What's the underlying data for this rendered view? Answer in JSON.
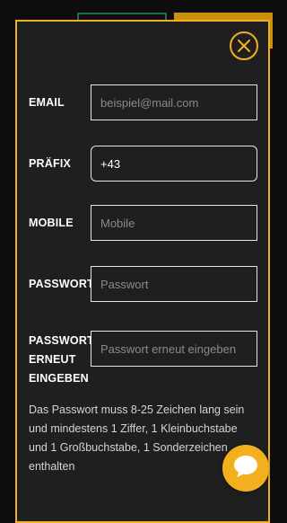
{
  "form": {
    "email": {
      "label": "EMAIL",
      "placeholder": "beispiel@mail.com",
      "value": ""
    },
    "prefix": {
      "label": "PRÄFIX",
      "value": "+43"
    },
    "mobile": {
      "label": "MOBILE",
      "placeholder": "Mobile",
      "value": ""
    },
    "password": {
      "label": "PASSWORT",
      "placeholder": "Passwort",
      "value": ""
    },
    "password_repeat": {
      "label_lines": [
        "PASSWORT",
        "ERNEUT",
        "EINGEBEN"
      ],
      "placeholder": "Passwort erneut eingeben",
      "value": ""
    },
    "password_hint": "Das Passwort muss 8-25 Zeichen lang sein und mindestens 1 Ziffer, 1 Kleinbuchstabe und 1 Großbuchstabe, 1 Sonderzeichen enthalten"
  },
  "icons": {
    "close": "close-icon",
    "chat": "chat-bubble-icon"
  },
  "colors": {
    "accent": "#f2b01e",
    "modal_bg": "#1f1f1f",
    "page_bg": "#0d0d0d",
    "input_border": "#e6e6e6",
    "placeholder": "#8a8a8a",
    "hint_text": "#d4d4d4",
    "bg_tab_green_border": "#1f6b4f",
    "bg_tab_gold": "#c8900e"
  }
}
